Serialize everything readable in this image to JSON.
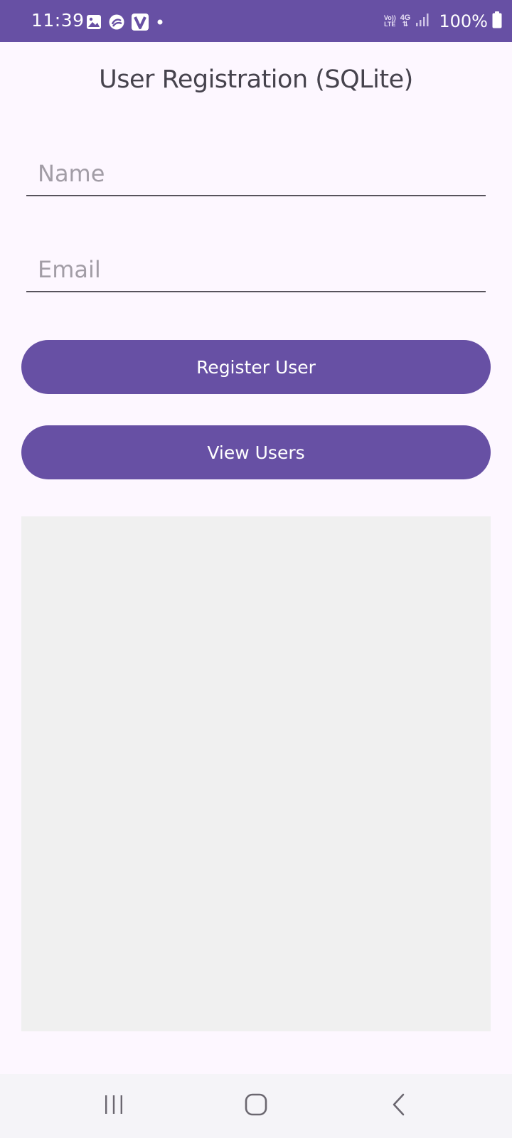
{
  "status_bar": {
    "time": "11:39",
    "volte_top": "Vo))",
    "volte_bottom": "LTE",
    "network": "4G",
    "battery": "100%",
    "icons_left": [
      "gallery-icon",
      "sync-app-icon",
      "v-app-icon",
      "dot-icon"
    ],
    "icons_right": [
      "volte-icon",
      "network-4g-icon",
      "signal-icon",
      "battery-icon"
    ]
  },
  "page": {
    "title": "User Registration (SQLite)"
  },
  "form": {
    "name_placeholder": "Name",
    "name_value": "",
    "email_placeholder": "Email",
    "email_value": ""
  },
  "buttons": {
    "register_label": "Register User",
    "view_label": "View Users"
  },
  "users_list": {
    "items": []
  },
  "nav": {
    "icons": [
      "recents-icon",
      "home-icon",
      "back-icon"
    ]
  },
  "colors": {
    "primary": "#6750a4",
    "background": "#fdf7ff",
    "list_background": "#f0f0f0",
    "title_text": "#46434d",
    "placeholder": "#a29da6"
  }
}
